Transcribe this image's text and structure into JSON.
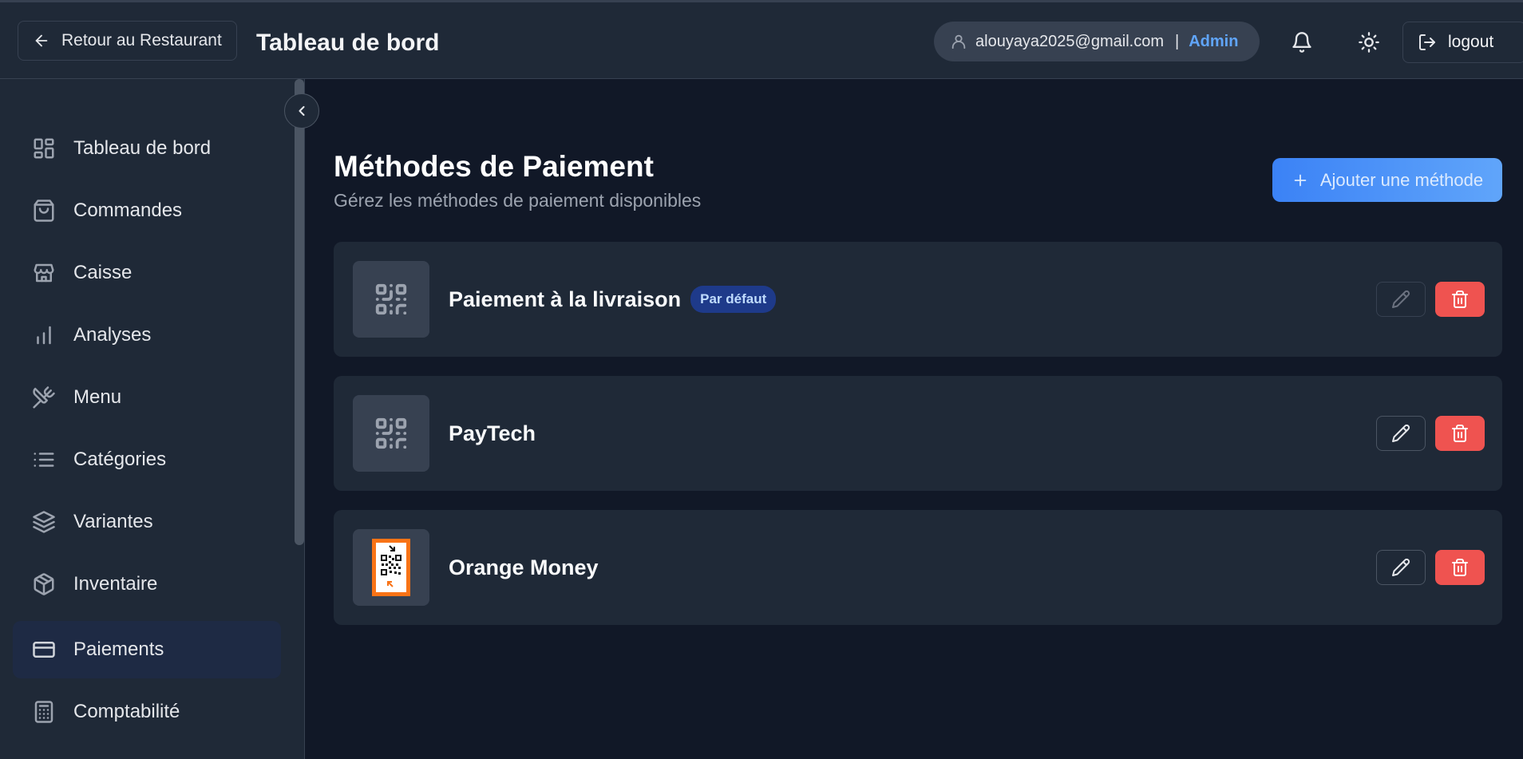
{
  "header": {
    "back_label": "Retour au Restaurant",
    "title": "Tableau de bord",
    "user_email": "alouyaya2025@gmail.com",
    "separator": "|",
    "user_role": "Admin",
    "logout_label": "logout"
  },
  "sidebar": {
    "items": [
      {
        "label": "Tableau de bord",
        "icon": "dashboard-icon"
      },
      {
        "label": "Commandes",
        "icon": "shopping-bag-icon"
      },
      {
        "label": "Caisse",
        "icon": "store-icon"
      },
      {
        "label": "Analyses",
        "icon": "bar-chart-icon"
      },
      {
        "label": "Menu",
        "icon": "utensils-icon"
      },
      {
        "label": "Catégories",
        "icon": "list-icon"
      },
      {
        "label": "Variantes",
        "icon": "layers-icon"
      },
      {
        "label": "Inventaire",
        "icon": "package-icon"
      },
      {
        "label": "Paiements",
        "icon": "credit-card-icon",
        "active": true
      },
      {
        "label": "Comptabilité",
        "icon": "calculator-icon"
      }
    ]
  },
  "main": {
    "title": "Méthodes de Paiement",
    "subtitle": "Gérez les méthodes de paiement disponibles",
    "add_label": "Ajouter une méthode",
    "methods": [
      {
        "name": "Paiement à la livraison",
        "badge": "Par défaut",
        "icon": "qr-code-icon"
      },
      {
        "name": "PayTech",
        "icon": "qr-code-icon"
      },
      {
        "name": "Orange Money",
        "icon": "orange-money-logo"
      }
    ]
  },
  "colors": {
    "background": "#111827",
    "panel": "#1f2937",
    "accent": "#3b82f6",
    "role": "#60a5fa",
    "danger": "#ef5350",
    "orange": "#f97316"
  }
}
